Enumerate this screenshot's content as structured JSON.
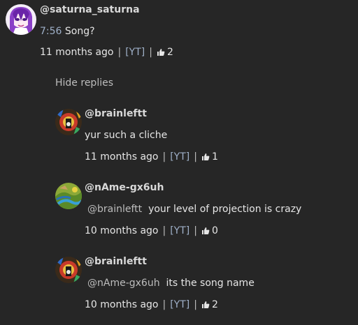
{
  "comment": {
    "author": "@saturna_saturna",
    "timestamp_link": "7:56",
    "text": " Song?",
    "age": "11 months ago",
    "source": "[YT]",
    "likes": "2"
  },
  "hide_replies_label": "Hide replies",
  "replies": [
    {
      "author": "@brainleftt",
      "mention": "",
      "text": "yur such a cliche",
      "age": "11 months ago",
      "source": "[YT]",
      "likes": "1"
    },
    {
      "author": "@nAme-gx6uh",
      "mention": "@brainleftt",
      "text": "your level of projection is crazy",
      "age": "10 months ago",
      "source": "[YT]",
      "likes": "0"
    },
    {
      "author": "@brainleftt",
      "mention": "@nAme-gx6uh",
      "text": "its the song name",
      "age": "10 months ago",
      "source": "[YT]",
      "likes": "2"
    }
  ],
  "separator": "|",
  "icons": {
    "like": "thumbs-up-icon"
  },
  "colors": {
    "background": "#262626",
    "text": "#e6e6e6",
    "link": "#9fb0c8",
    "muted": "#bdbdbd"
  }
}
